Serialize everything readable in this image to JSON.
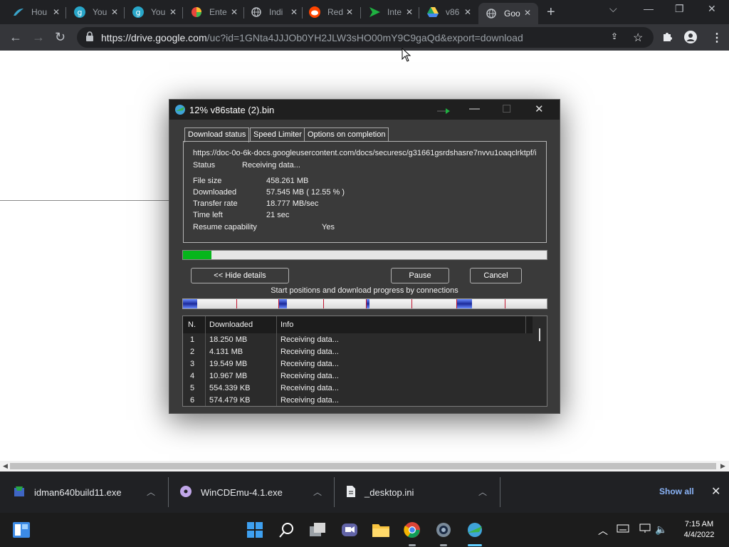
{
  "browser": {
    "tabs": [
      {
        "title": "Hou",
        "icon": "feather-icon"
      },
      {
        "title": "You",
        "icon": "g-icon"
      },
      {
        "title": "You",
        "icon": "g-icon"
      },
      {
        "title": "Ente",
        "icon": "pinwheel-icon"
      },
      {
        "title": "Indi",
        "icon": "globe-icon"
      },
      {
        "title": "Red",
        "icon": "reddit-icon"
      },
      {
        "title": "Inte",
        "icon": "play-icon"
      },
      {
        "title": "v86",
        "icon": "drive-icon"
      },
      {
        "title": "Goo",
        "icon": "globe-icon"
      }
    ],
    "url_domain": "https://drive.google.com",
    "url_path": "/uc?id=1GNta4JJJOb0YH2JLW3sHO00mY9C9gaQd&export=download"
  },
  "idm": {
    "title": "12% v86state (2).bin",
    "tabs": [
      "Download status",
      "Speed Limiter",
      "Options on completion"
    ],
    "url": "https://doc-0o-6k-docs.googleusercontent.com/docs/securesc/g31661gsrdshasre7nvvu1oaqclrktpf/i",
    "status_label": "Status",
    "status_value": "Receiving data...",
    "file_size_label": "File size",
    "file_size_value": "458.261  MB",
    "downloaded_label": "Downloaded",
    "downloaded_value": "57.545  MB  ( 12.55 % )",
    "transfer_rate_label": "Transfer rate",
    "transfer_rate_value": "18.777  MB/sec",
    "time_left_label": "Time left",
    "time_left_value": "21 sec",
    "resume_label": "Resume capability",
    "resume_value": "Yes",
    "progress_fraction": 0.0789,
    "hide_details": "<< Hide details",
    "pause": "Pause",
    "cancel": "Cancel",
    "connections_caption": "Start positions and download progress by connections",
    "columns": [
      "N.",
      "Downloaded",
      "Info"
    ],
    "rows": [
      {
        "n": "1",
        "downloaded": "18.250  MB",
        "info": "Receiving data..."
      },
      {
        "n": "2",
        "downloaded": "4.131  MB",
        "info": "Receiving data..."
      },
      {
        "n": "3",
        "downloaded": "19.549  MB",
        "info": "Receiving data..."
      },
      {
        "n": "4",
        "downloaded": "10.967  MB",
        "info": "Receiving data..."
      },
      {
        "n": "5",
        "downloaded": "554.339  KB",
        "info": "Receiving data..."
      },
      {
        "n": "6",
        "downloaded": "574.479  KB",
        "info": "Receiving data..."
      }
    ]
  },
  "downloads_shelf": {
    "items": [
      "idman640build11.exe",
      "WinCDEmu-4.1.exe",
      "_desktop.ini"
    ],
    "show_all": "Show all"
  },
  "taskbar": {
    "time": "7:15 AM",
    "date": "4/4/2022"
  },
  "colors": {
    "progress_green": "#06b61c",
    "tab_strip": "#202124",
    "link_blue": "#8ab4f8"
  }
}
